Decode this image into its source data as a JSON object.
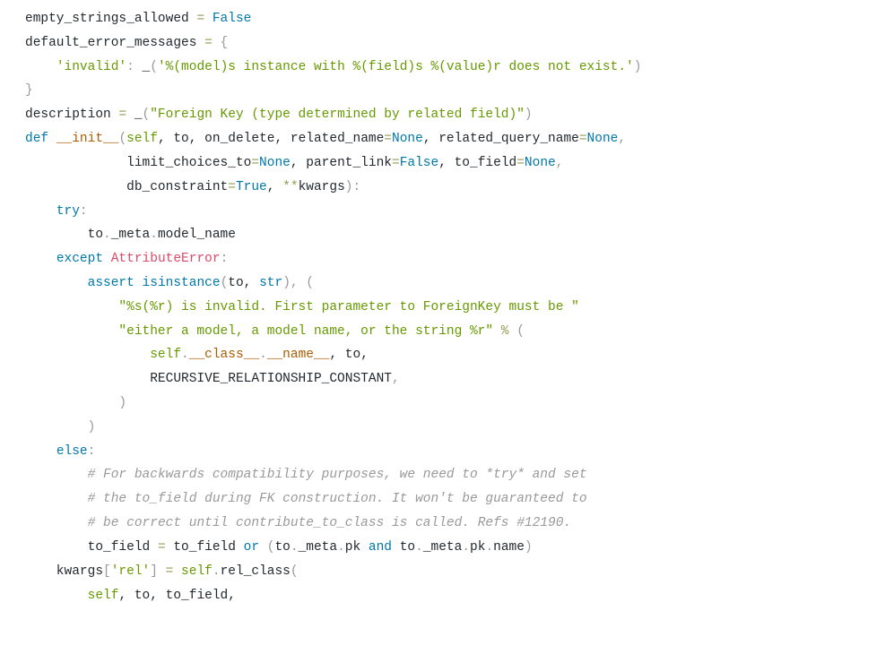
{
  "lines": {
    "l1_a": "empty_strings_allowed ",
    "l1_b": "=",
    "l1_c": " ",
    "l1_false": "False",
    "l2_a": "default_error_messages ",
    "l2_b": "=",
    "l2_c": " ",
    "l2_brace": "{",
    "l3_pad": "    ",
    "l3_key": "'invalid'",
    "l3_colon": ":",
    "l3_sp": " _",
    "l3_open": "(",
    "l3_str": "'%(model)s instance with %(field)s %(value)r does not exist.'",
    "l3_close": ")",
    "l4_brace": "}",
    "l5_a": "description ",
    "l5_b": "=",
    "l5_c": " _",
    "l5_open": "(",
    "l5_str": "\"Foreign Key (type determined by related field)\"",
    "l5_close": ")",
    "blank": "",
    "l7_def": "def",
    "l7_sp1": " ",
    "l7_init": "__init__",
    "l7_open": "(",
    "l7_self": "self",
    "l7_rest1": ", to, on_delete, related_name",
    "l7_eq1": "=",
    "l7_none1": "None",
    "l7_rest2": ", related_query_name",
    "l7_eq2": "=",
    "l7_none2": "None",
    "l7_comma": ",",
    "l8_pad": "             limit_choices_to",
    "l8_eq1": "=",
    "l8_none1": "None",
    "l8_mid": ", parent_link",
    "l8_eq2": "=",
    "l8_false": "False",
    "l8_mid2": ", to_field",
    "l8_eq3": "=",
    "l8_none2": "None",
    "l8_comma": ",",
    "l9_pad": "             db_constraint",
    "l9_eq": "=",
    "l9_true": "True",
    "l9_mid": ", ",
    "l9_star": "**",
    "l9_kwargs": "kwargs",
    "l9_close": "):",
    "l10_pad": "    ",
    "l10_try": "try",
    "l10_colon": ":",
    "l11_pad": "        to",
    "l11_dot": ".",
    "l11_meta": "_meta",
    "l11_dot2": ".",
    "l11_model": "model_name",
    "l12_pad": "    ",
    "l12_except": "except",
    "l12_sp": " ",
    "l12_err": "AttributeError",
    "l12_colon": ":",
    "l13_pad": "        ",
    "l13_assert": "assert",
    "l13_sp": " ",
    "l13_isinst": "isinstance",
    "l13_open": "(",
    "l13_args": "to, ",
    "l13_str": "str",
    "l13_close": "),",
    "l13_sp2": " ",
    "l13_open2": "(",
    "l14_pad": "            ",
    "l14_str": "\"%s(%r) is invalid. First parameter to ForeignKey must be \"",
    "l15_pad": "            ",
    "l15_str": "\"either a model, a model name, or the string %r\"",
    "l15_sp": " ",
    "l15_mod": "%",
    "l15_sp2": " ",
    "l15_open": "(",
    "l16_pad": "                ",
    "l16_self": "self",
    "l16_dot": ".",
    "l16_class": "__class__",
    "l16_dot2": ".",
    "l16_name": "__name__",
    "l16_rest": ", to,",
    "l17_pad": "                RECURSIVE_RELATIONSHIP_CONSTANT",
    "l17_comma": ",",
    "l18_pad": "            ",
    "l18_close": ")",
    "l19_pad": "        ",
    "l19_close": ")",
    "l20_pad": "    ",
    "l20_else": "else",
    "l20_colon": ":",
    "l21_pad": "        ",
    "l21_c": "# For backwards compatibility purposes, we need to *try* and set",
    "l22_pad": "        ",
    "l22_c": "# the to_field during FK construction. It won't be guaranteed to",
    "l23_pad": "        ",
    "l23_c": "# be correct until contribute_to_class is called. Refs #12190.",
    "l24_pad": "        to_field ",
    "l24_eq": "=",
    "l24_sp": " to_field ",
    "l24_or": "or",
    "l24_sp2": " ",
    "l24_open": "(",
    "l24_to": "to",
    "l24_dot": ".",
    "l24_meta": "_meta",
    "l24_dot2": ".",
    "l24_pk": "pk ",
    "l24_and": "and",
    "l24_sp3": " to",
    "l24_dot3": ".",
    "l24_meta2": "_meta",
    "l24_dot4": ".",
    "l24_pk2": "pk",
    "l24_dot5": ".",
    "l24_name": "name",
    "l24_close": ")",
    "l26_pad": "    kwargs",
    "l26_open": "[",
    "l26_key": "'rel'",
    "l26_close": "]",
    "l26_sp": " ",
    "l26_eq": "=",
    "l26_sp2": " ",
    "l26_self": "self",
    "l26_dot": ".",
    "l26_rel": "rel_class",
    "l26_open2": "(",
    "l27_pad": "        ",
    "l27_self": "self",
    "l27_rest": ", to, to_field,"
  }
}
